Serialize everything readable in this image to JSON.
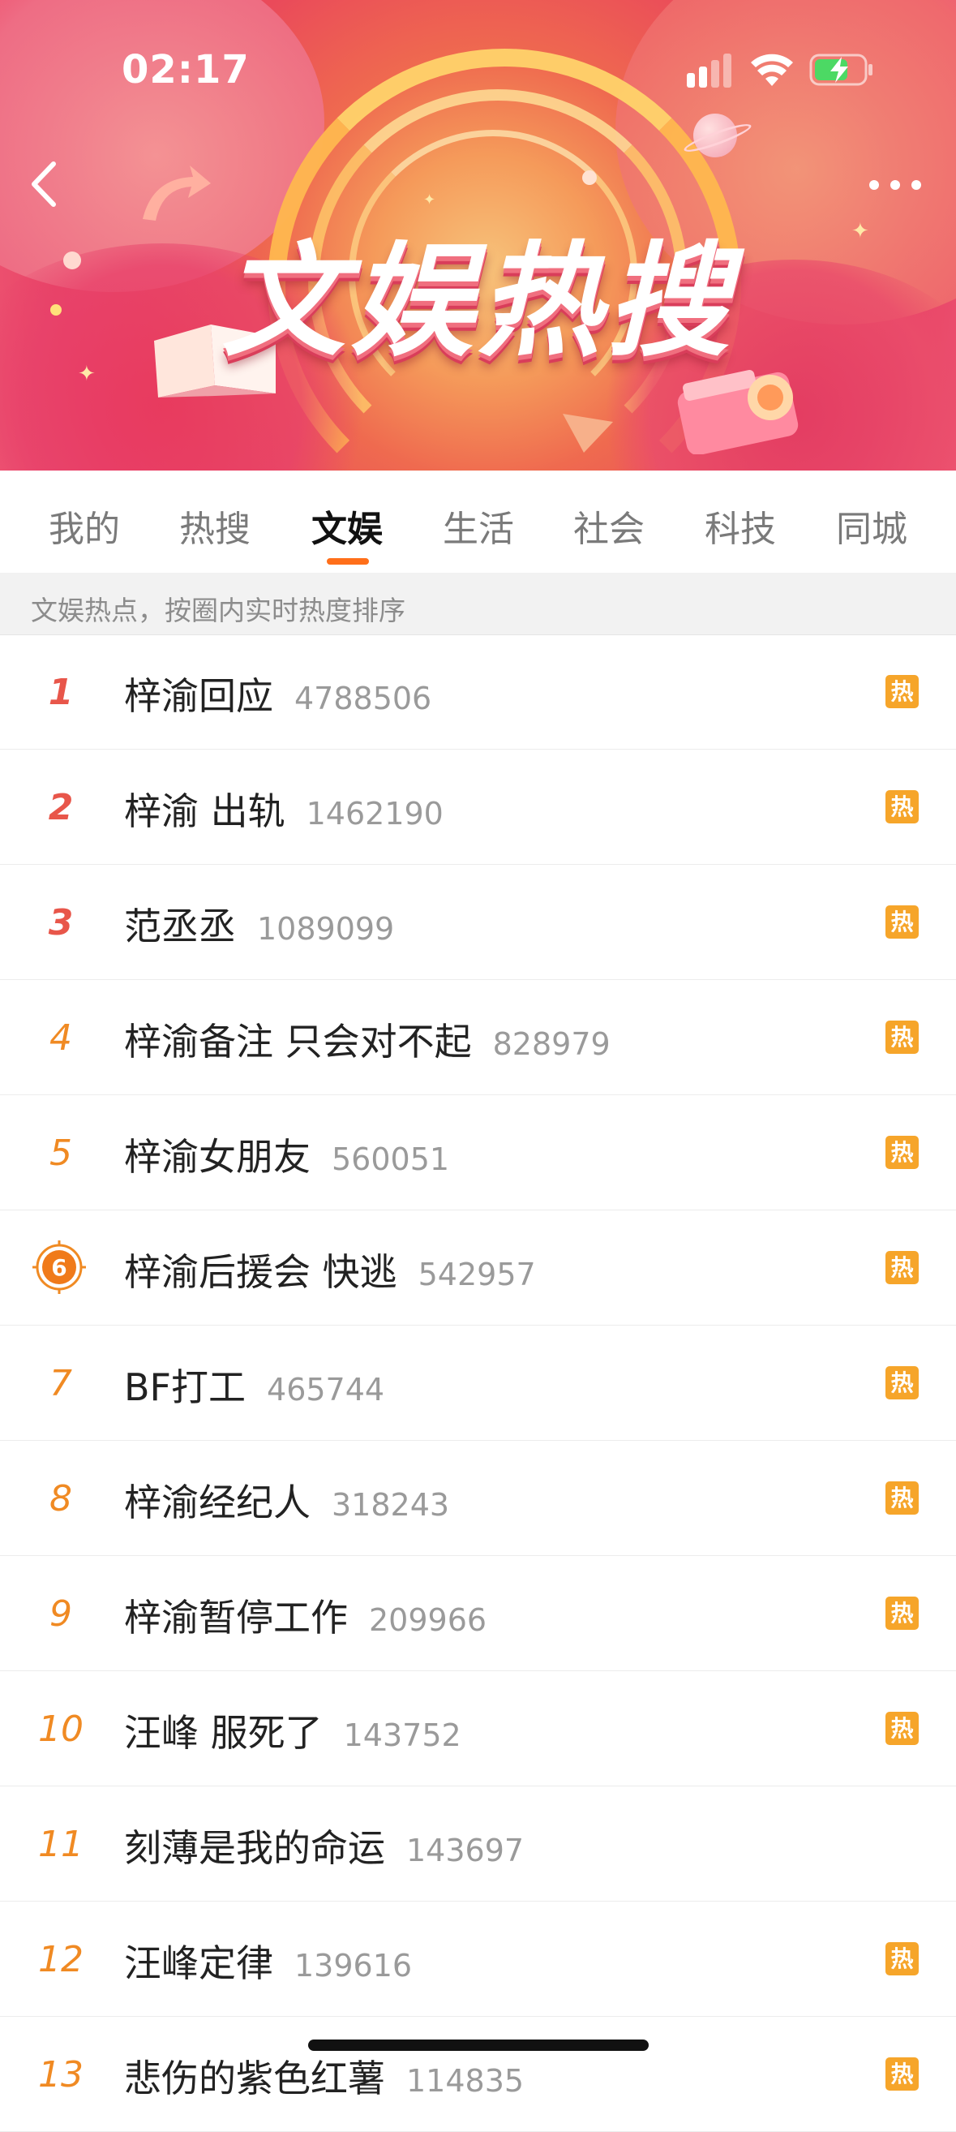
{
  "status_bar": {
    "time": "02:17"
  },
  "banner": {
    "title": "文娱热搜"
  },
  "tabs": [
    {
      "label": "我的"
    },
    {
      "label": "热搜"
    },
    {
      "label": "文娱",
      "active": true
    },
    {
      "label": "生活"
    },
    {
      "label": "社会"
    },
    {
      "label": "科技"
    },
    {
      "label": "同城"
    }
  ],
  "subheader": {
    "text": "文娱热点，按圈内实时热度排序"
  },
  "hot_badge_label": "热",
  "list": [
    {
      "rank": "1",
      "title": "梓渝回应",
      "count": "4788506",
      "hot": true
    },
    {
      "rank": "2",
      "title": "梓渝 出轨",
      "count": "1462190",
      "hot": true
    },
    {
      "rank": "3",
      "title": "范丞丞",
      "count": "1089099",
      "hot": true
    },
    {
      "rank": "4",
      "title": "梓渝备注 只会对不起",
      "count": "828979",
      "hot": true
    },
    {
      "rank": "5",
      "title": "梓渝女朋友",
      "count": "560051",
      "hot": true
    },
    {
      "rank": "6",
      "title": "梓渝后援会 快逃",
      "count": "542957",
      "hot": true
    },
    {
      "rank": "7",
      "title": "BF打工",
      "count": "465744",
      "hot": true
    },
    {
      "rank": "8",
      "title": "梓渝经纪人",
      "count": "318243",
      "hot": true
    },
    {
      "rank": "9",
      "title": "梓渝暂停工作",
      "count": "209966",
      "hot": true
    },
    {
      "rank": "10",
      "title": "汪峰 服死了",
      "count": "143752",
      "hot": true
    },
    {
      "rank": "11",
      "title": "刻薄是我的命运",
      "count": "143697",
      "hot": false
    },
    {
      "rank": "12",
      "title": "汪峰定律",
      "count": "139616",
      "hot": true
    },
    {
      "rank": "13",
      "title": "悲伤的紫色红薯",
      "count": "114835",
      "hot": true
    }
  ],
  "colors": {
    "accent": "#ff6f1a",
    "rank_top": "#e8564a",
    "rank_other": "#f08a23",
    "hot_badge": "#f6a52a"
  }
}
